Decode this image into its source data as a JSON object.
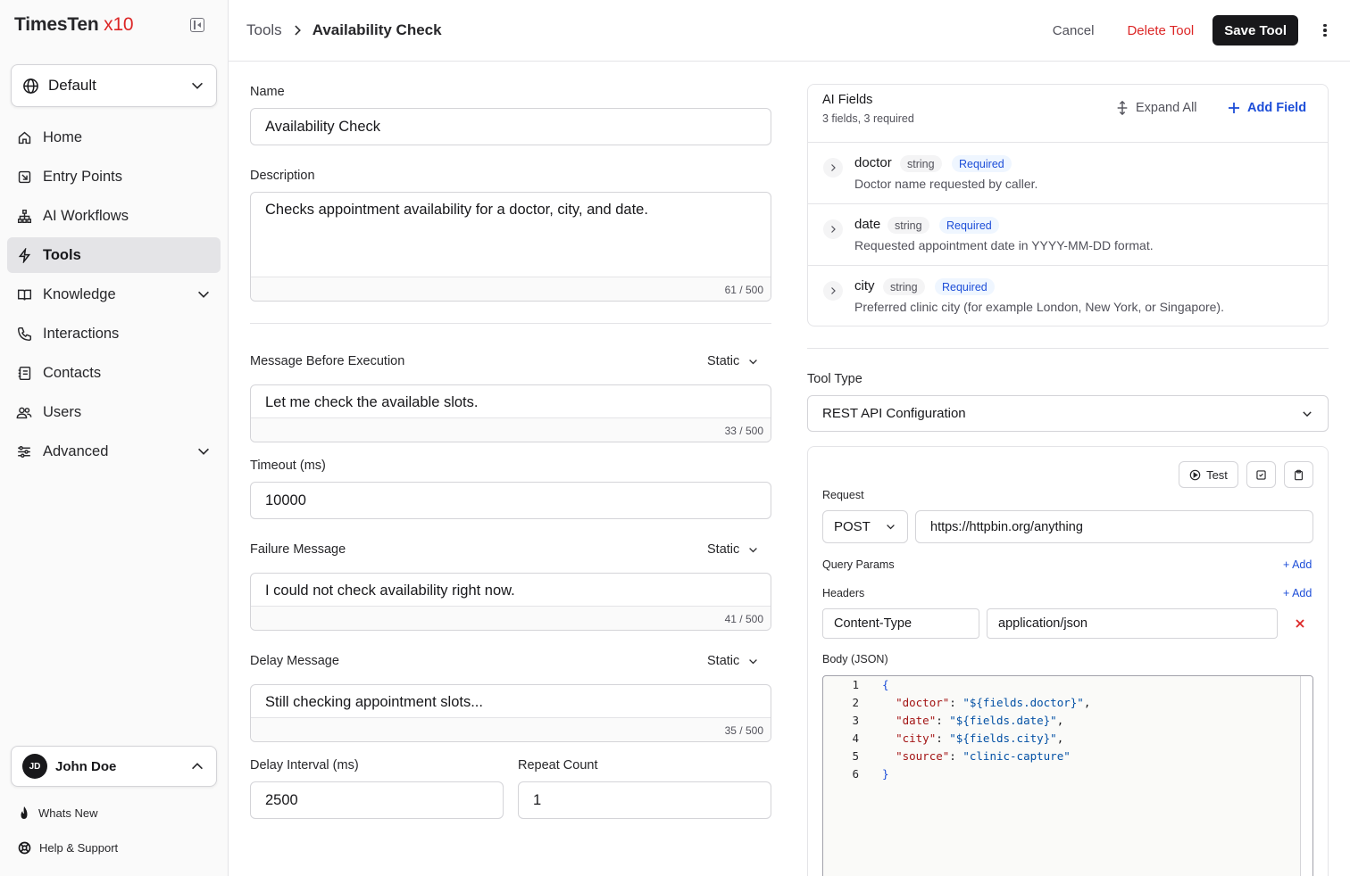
{
  "brand": {
    "name_a": "Times",
    "name_b": "Ten",
    "name_c": " x10"
  },
  "workspace": {
    "label": "Default"
  },
  "nav": [
    {
      "label": "Home",
      "icon": "home-icon"
    },
    {
      "label": "Entry Points",
      "icon": "entry-icon"
    },
    {
      "label": "AI Workflows",
      "icon": "workflow-icon"
    },
    {
      "label": "Tools",
      "icon": "bolt-icon",
      "active": true
    },
    {
      "label": "Knowledge",
      "icon": "book-icon",
      "expandable": true
    },
    {
      "label": "Interactions",
      "icon": "phone-icon"
    },
    {
      "label": "Contacts",
      "icon": "contacts-icon"
    },
    {
      "label": "Users",
      "icon": "users-icon"
    },
    {
      "label": "Advanced",
      "icon": "sliders-icon",
      "expandable": true
    }
  ],
  "user": {
    "initials": "JD",
    "name": "John Doe"
  },
  "footer": {
    "whats_new": "Whats New",
    "help": "Help & Support"
  },
  "header": {
    "crumb_parent": "Tools",
    "crumb_current": "Availability Check",
    "cancel": "Cancel",
    "delete": "Delete Tool",
    "save": "Save Tool"
  },
  "form": {
    "name_label": "Name",
    "name_value": "Availability Check",
    "description_label": "Description",
    "description_value": "Checks appointment availability for a doctor, city, and date.",
    "description_count": "61 / 500",
    "msg_before_label": "Message Before Execution",
    "msg_before_mode": "Static",
    "msg_before_value": "Let me check the available slots.",
    "msg_before_count": "33 / 500",
    "timeout_label": "Timeout (ms)",
    "timeout_value": "10000",
    "failure_label": "Failure Message",
    "failure_mode": "Static",
    "failure_value": "I could not check availability right now.",
    "failure_count": "41 / 500",
    "delay_label": "Delay Message",
    "delay_mode": "Static",
    "delay_value": "Still checking appointment slots...",
    "delay_count": "35 / 500",
    "delay_interval_label": "Delay Interval (ms)",
    "delay_interval_value": "2500",
    "repeat_label": "Repeat Count",
    "repeat_value": "1"
  },
  "ai_fields": {
    "title": "AI Fields",
    "subtitle": "3 fields, 3 required",
    "expand_all": "Expand All",
    "add_field": "Add Field",
    "fields": [
      {
        "name": "doctor",
        "type": "string",
        "required": "Required",
        "description": "Doctor name requested by caller."
      },
      {
        "name": "date",
        "type": "string",
        "required": "Required",
        "description": "Requested appointment date in YYYY-MM-DD format."
      },
      {
        "name": "city",
        "type": "string",
        "required": "Required",
        "description": "Preferred clinic city (for example London, New York, or Singapore)."
      }
    ]
  },
  "tool_type": {
    "label": "Tool Type",
    "value": "REST API Configuration"
  },
  "request": {
    "test": "Test",
    "label": "Request",
    "method": "POST",
    "url": "https://httpbin.org/anything",
    "query_params_label": "Query Params",
    "query_add": "+ Add",
    "headers_label": "Headers",
    "headers_add": "+ Add",
    "header_key": "Content-Type",
    "header_value": "application/json",
    "body_label": "Body (JSON)",
    "body_lines": [
      {
        "n": "1",
        "k": "",
        "v": "",
        "text": "{"
      },
      {
        "n": "2",
        "k": "\"doctor\"",
        "v": "\"${fields.doctor}\"",
        "end": ","
      },
      {
        "n": "3",
        "k": "\"date\"",
        "v": "\"${fields.date}\"",
        "end": ","
      },
      {
        "n": "4",
        "k": "\"city\"",
        "v": "\"${fields.city}\"",
        "end": ","
      },
      {
        "n": "5",
        "k": "\"source\"",
        "v": "\"clinic-capture\"",
        "end": ""
      },
      {
        "n": "6",
        "k": "",
        "v": "",
        "text": "}"
      }
    ]
  },
  "colors": {
    "accent": "#dc2626",
    "link": "#1d4ed8",
    "primary": "#18181b"
  }
}
